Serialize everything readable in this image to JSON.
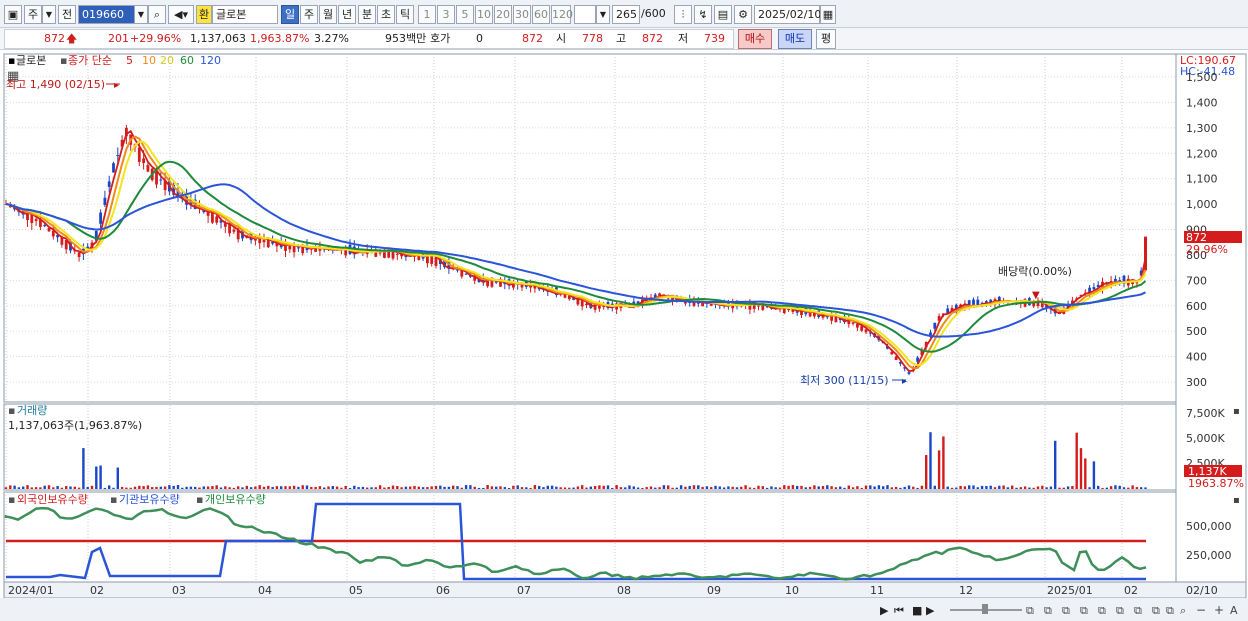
{
  "toolbar": {
    "type_label": "주",
    "prev_label": "전",
    "stock_code": "019660",
    "currency_badge": "환",
    "stock_name": "글로본",
    "period_tabs": [
      "일",
      "주",
      "월",
      "년",
      "분",
      "초",
      "틱"
    ],
    "period_selected": "일",
    "interval_buttons": [
      "1",
      "3",
      "5",
      "10",
      "20",
      "30",
      "60",
      "120"
    ],
    "count_value": "265",
    "count_max": "/600",
    "date_value": "2025/02/10"
  },
  "quote": {
    "price": "872",
    "change": "201",
    "change_pct": "+29.96%",
    "volume": "1,137,063",
    "volume_pct": "1,963.87%",
    "turnover": "3.27%",
    "amount": "953백만",
    "hoga_label": "호가",
    "hoga_value": "0",
    "hoga_price": "872",
    "open_label": "시",
    "open_value": "778",
    "high_label": "고",
    "high_value": "872",
    "low_label": "저",
    "low_value": "739",
    "buy_label": "매수",
    "sell_label": "매도",
    "pyeong_label": "평"
  },
  "price_pane": {
    "legend_name": "글로본",
    "legend_ma_prefix": "종가 단순",
    "ma_periods": [
      "5",
      "10",
      "20",
      "60",
      "120"
    ],
    "ma_colors": [
      "#d41c1c",
      "#f08a1c",
      "#f2e51e",
      "#1f8a3b",
      "#2a55d8"
    ],
    "lc_label": "LC:190.67",
    "hc_label": "HC:-41.48",
    "high_annotation": "최고 1,490 (02/15)",
    "low_annotation": "최저 300 (11/15)",
    "dividend_annotation": "배당락(0.00%)",
    "current_price_tag": "872",
    "current_pct_tag": "29.96%",
    "y_ticks": [
      "1,500",
      "1,400",
      "1,300",
      "1,200",
      "1,100",
      "1,000",
      "900",
      "800",
      "700",
      "600",
      "500",
      "400",
      "300"
    ]
  },
  "volume_pane": {
    "title": "거래량",
    "summary": "1,137,063주(1,963.87%)",
    "y_ticks": [
      "7,500K",
      "5,000K",
      "2,500K"
    ],
    "current_tag": "1,137K",
    "current_pct_tag": "1963.87%"
  },
  "holdings_pane": {
    "legend_items": [
      "외국인보유수량",
      "기관보유수량",
      "개인보유수량"
    ],
    "legend_colors": [
      "#d41c1c",
      "#2a55d8",
      "#1f8a3b"
    ],
    "y_ticks": [
      "500,000",
      "250,000"
    ]
  },
  "x_axis": {
    "labels": [
      "2024/01",
      "02",
      "03",
      "04",
      "05",
      "06",
      "07",
      "08",
      "09",
      "10",
      "11",
      "12",
      "2025/01",
      "02"
    ],
    "right_label": "02/10"
  },
  "bottom_controls": [
    "▶",
    "⏮",
    "■",
    "▶",
    "─",
    "＋",
    "A"
  ]
}
